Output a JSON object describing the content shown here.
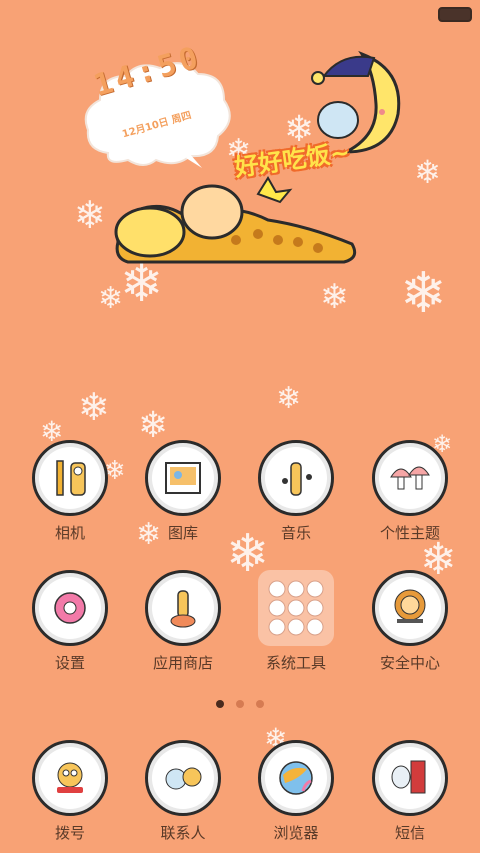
{
  "status": {
    "battery": "battery-icon"
  },
  "clock": {
    "time": "14:50",
    "date": "12月10日 周四"
  },
  "widget": {
    "slogan": "好好吃饭~"
  },
  "apps": [
    {
      "label": "相机",
      "icon": "camera-giraffe-icon"
    },
    {
      "label": "图库",
      "icon": "gallery-photo-icon"
    },
    {
      "label": "音乐",
      "icon": "music-giraffe-icon"
    },
    {
      "label": "个性主题",
      "icon": "mushroom-theme-icon"
    },
    {
      "label": "设置",
      "icon": "gear-settings-icon"
    },
    {
      "label": "应用商店",
      "icon": "giraffe-store-icon"
    },
    {
      "label": "系统工具",
      "icon": "tools-folder-icon"
    },
    {
      "label": "安全中心",
      "icon": "lion-security-icon"
    }
  ],
  "dock": [
    {
      "label": "拨号",
      "icon": "phone-giraffe-icon"
    },
    {
      "label": "联系人",
      "icon": "contacts-friends-icon"
    },
    {
      "label": "浏览器",
      "icon": "browser-globe-icon"
    },
    {
      "label": "短信",
      "icon": "mailbox-sms-icon"
    }
  ],
  "pager": {
    "pages": 3,
    "current": 1
  },
  "colors": {
    "background": "#f8a275",
    "accent": "#f4a05e",
    "label": "#5a3a28"
  }
}
